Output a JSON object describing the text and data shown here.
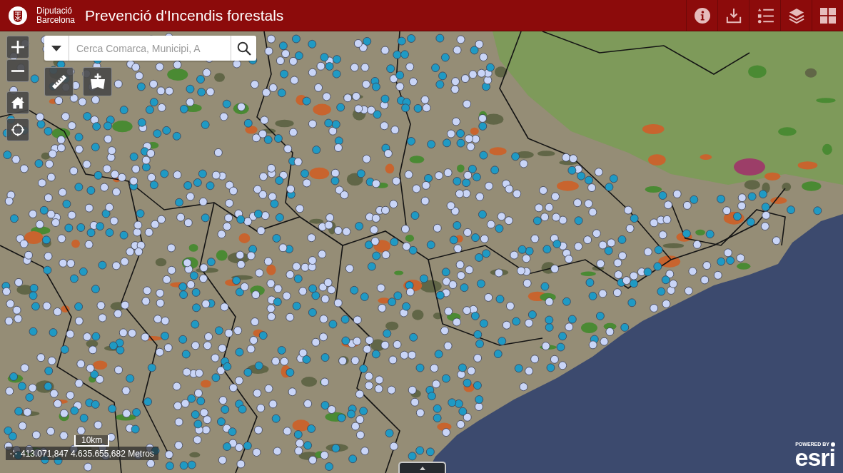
{
  "header": {
    "org_name": [
      "Diputació",
      "Barcelona"
    ],
    "title": "Prevenció d'Incendis forestals"
  },
  "search": {
    "placeholder": "Cerca Comarca, Municipi, A"
  },
  "map": {
    "scale_label": "10km",
    "coordinates": "413.071,847 4.635.655,682 Metros"
  },
  "attribution": {
    "tagline": "POWERED BY",
    "logo": "esri"
  }
}
